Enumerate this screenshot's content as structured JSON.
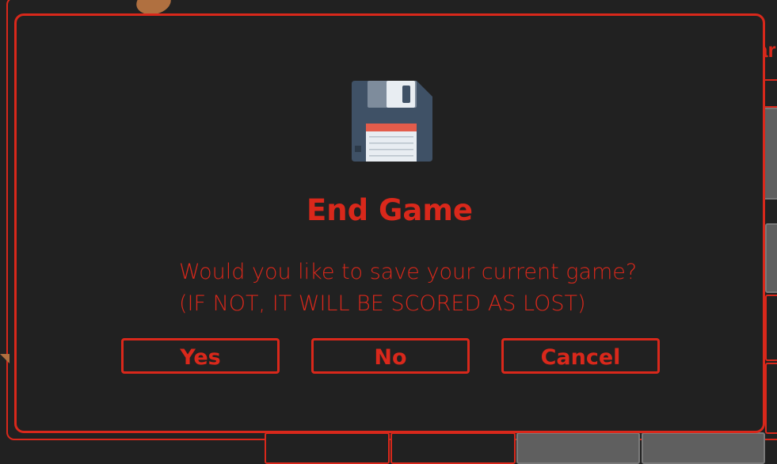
{
  "dialog": {
    "title": "End Game",
    "message_line1": "Would you like to save your current game?",
    "message_line2": "(IF NOT, IT WILL BE SCORED AS LOST)",
    "icon": "floppy-disk-icon",
    "buttons": {
      "yes": "Yes",
      "no": "No",
      "cancel": "Cancel"
    }
  },
  "background": {
    "partial_title": "ar"
  },
  "colors": {
    "accent": "#d9281b",
    "background": "#212121",
    "disk_body": "#3f5166",
    "disk_label": "#e35c4b"
  }
}
